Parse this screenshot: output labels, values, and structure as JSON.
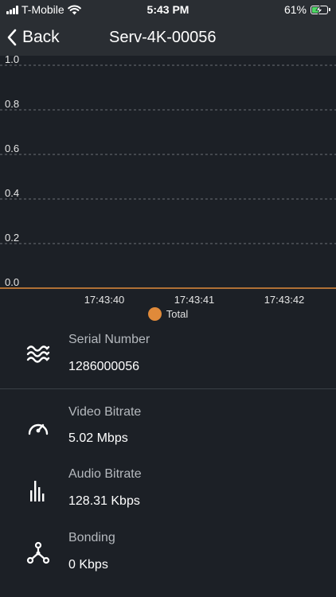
{
  "status_bar": {
    "carrier": "T-Mobile",
    "time": "5:43 PM",
    "battery_percent": "61%",
    "battery_level": 0.61,
    "icons": [
      "signal-icon",
      "wifi-icon",
      "battery-charging-icon"
    ]
  },
  "nav": {
    "back_label": "Back",
    "title": "Serv-4K-00056"
  },
  "chart_data": {
    "type": "line",
    "title": "",
    "xlabel": "",
    "ylabel": "",
    "ylim": [
      0.0,
      1.0
    ],
    "yticks": [
      "0.0",
      "0.2",
      "0.4",
      "0.6",
      "0.8",
      "1.0"
    ],
    "x": [
      "17:43:40",
      "17:43:41",
      "17:43:42"
    ],
    "series": [
      {
        "name": "Total",
        "values": [
          0,
          0,
          0
        ],
        "color": "#e08a3a"
      }
    ],
    "grid": true,
    "legend_position": "bottom"
  },
  "legend": {
    "total_label": "Total"
  },
  "info": {
    "serial": {
      "label": "Serial Number",
      "value": "1286000056",
      "icon": "waves-icon"
    },
    "video": {
      "label": "Video Bitrate",
      "value": "5.02 Mbps",
      "icon": "speedometer-icon"
    },
    "audio": {
      "label": "Audio Bitrate",
      "value": "128.31 Kbps",
      "icon": "audio-bars-icon"
    },
    "bonding": {
      "label": "Bonding",
      "value": "0 Kbps",
      "icon": "network-nodes-icon"
    }
  }
}
